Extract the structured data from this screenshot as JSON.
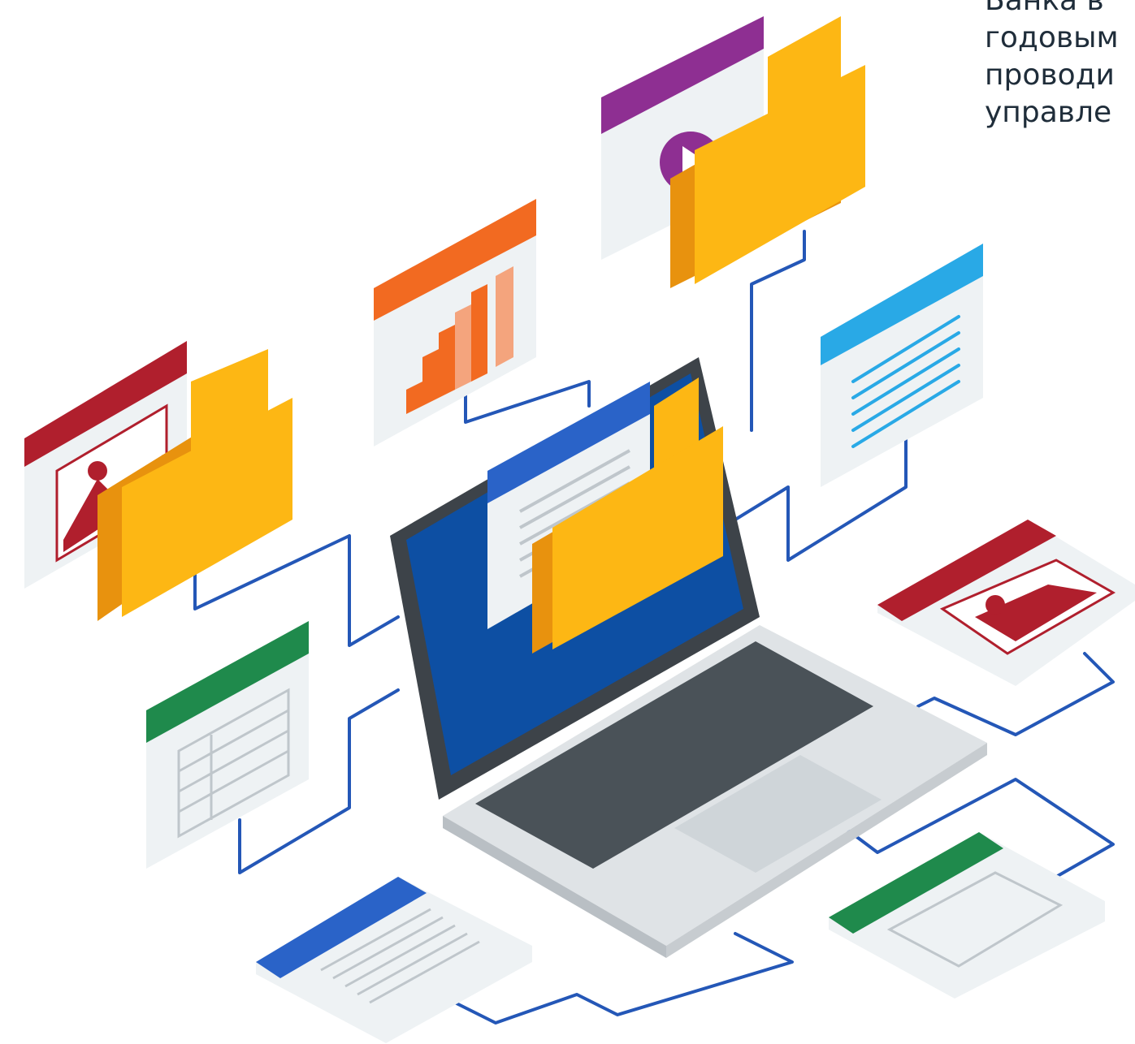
{
  "text_fragment": {
    "lines": [
      "Банка в",
      "годовым",
      "проводи",
      "управле"
    ]
  },
  "colors": {
    "folder": "#fdb714",
    "folder_shade": "#e8920e",
    "laptop_screen": "#0d4fa3",
    "laptop_bezel": "#3d4349",
    "laptop_body": "#dfe3e6",
    "keys": "#4a5258",
    "connector_line": "#2457b7",
    "red": "#b01f2d",
    "orange": "#f26a21",
    "purple": "#8e2f92",
    "light_blue": "#29a9e6",
    "green": "#1f8a4c",
    "blue": "#2a63c8",
    "card": "#eef2f4"
  }
}
